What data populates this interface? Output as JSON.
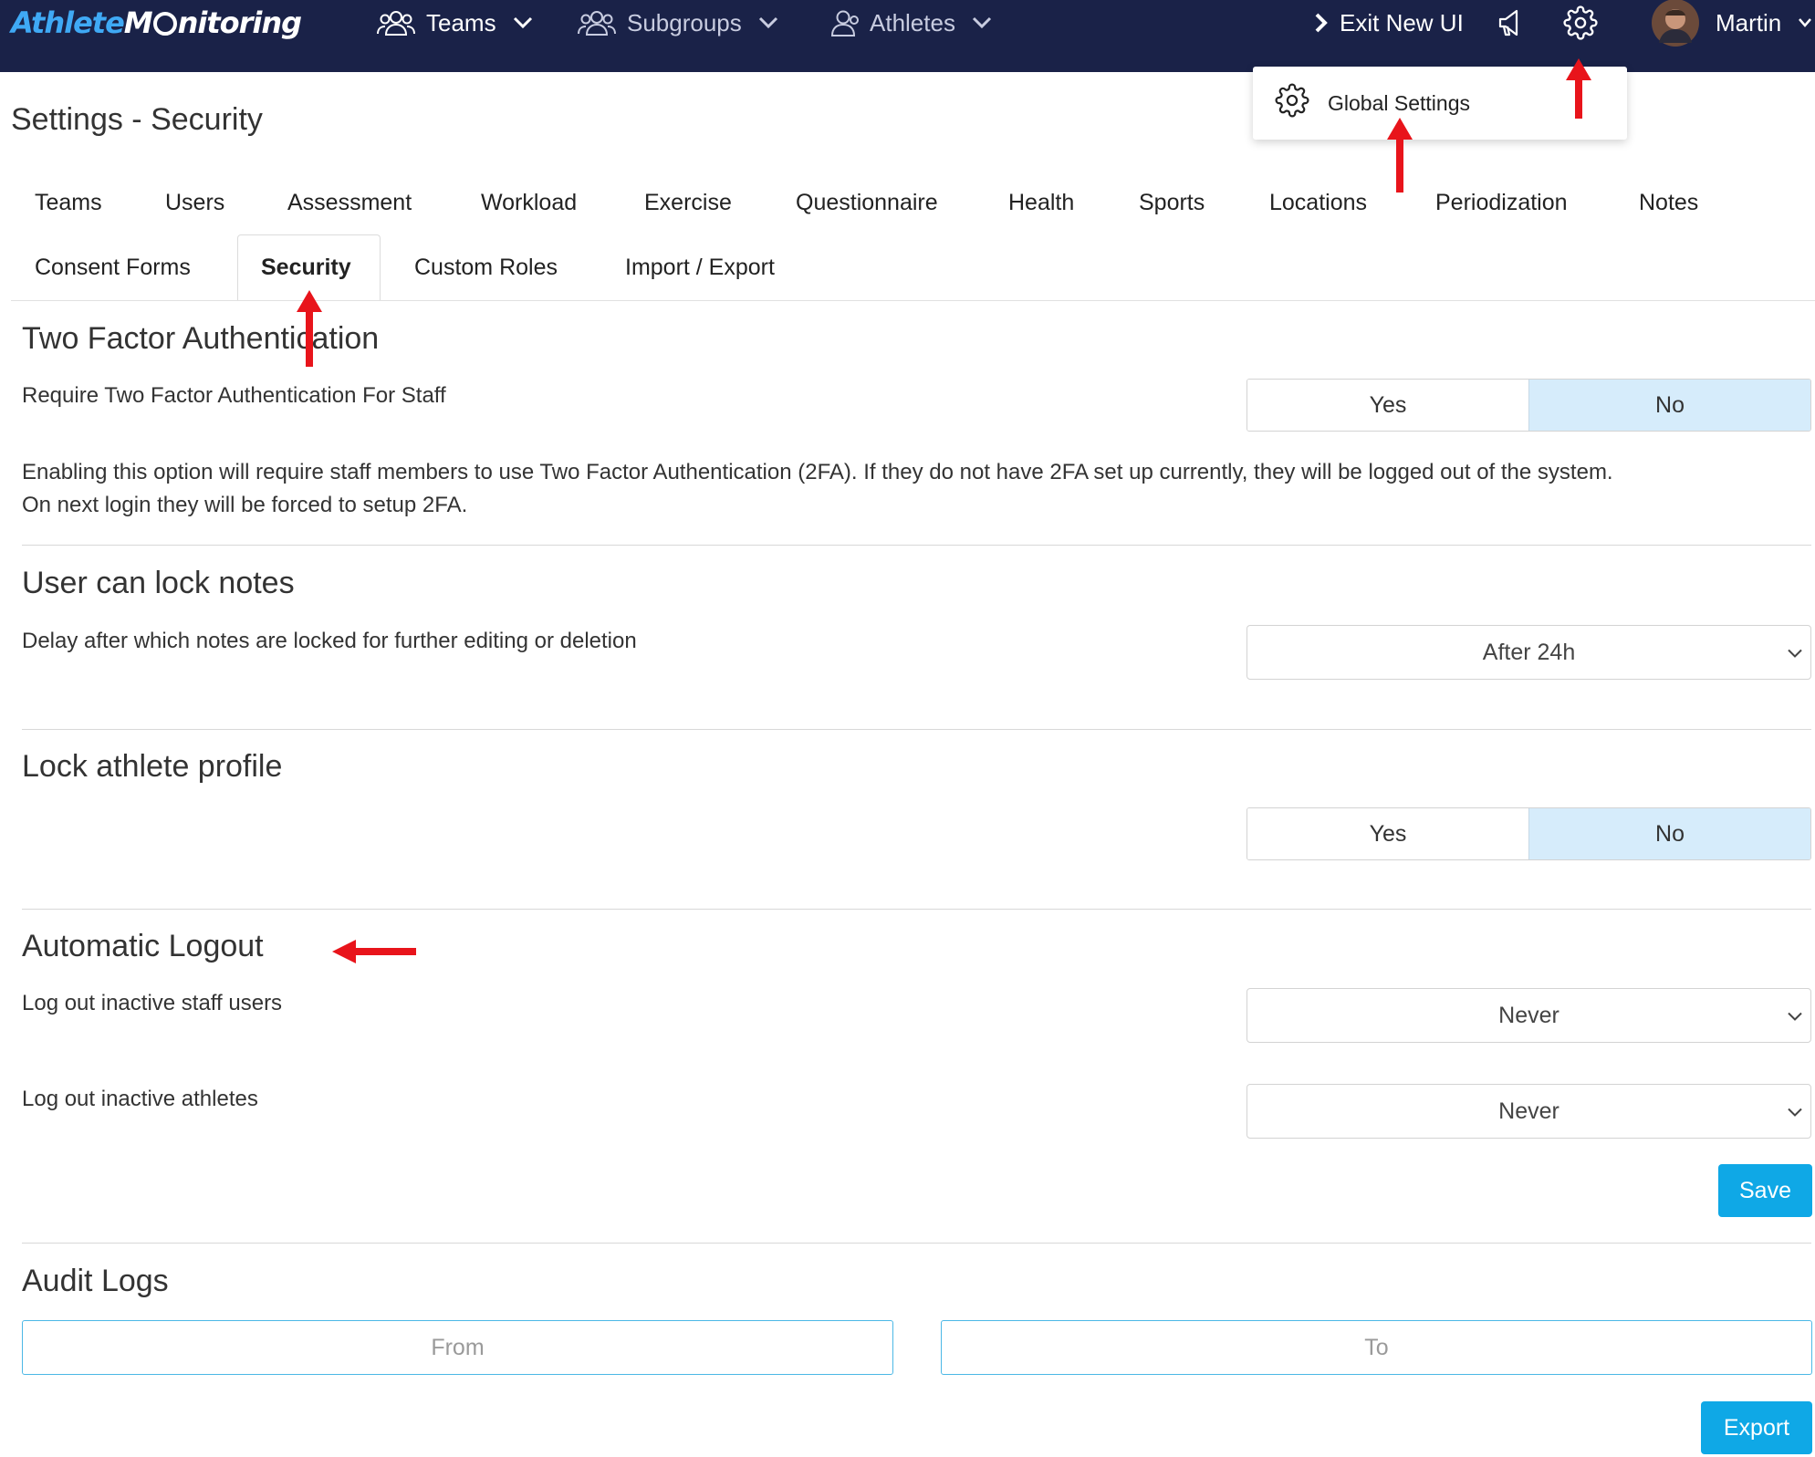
{
  "brand": {
    "logo_prefix": "Athlete",
    "logo_suffix_1": "M",
    "logo_suffix_2": "nitoring"
  },
  "topnav": {
    "teams_label": "Teams",
    "subgroups_label": "Subgroups",
    "athletes_label": "Athletes",
    "exit_label": "Exit New UI",
    "user_name": "Martin"
  },
  "settings_menu": {
    "global_settings_label": "Global Settings"
  },
  "page": {
    "title": "Settings - Security"
  },
  "tabs": {
    "row1": [
      "Teams",
      "Users",
      "Assessment",
      "Workload",
      "Exercise",
      "Questionnaire",
      "Health",
      "Sports",
      "Locations",
      "Periodization",
      "Notes"
    ],
    "row2": [
      "Consent Forms",
      "Security",
      "Custom Roles",
      "Import / Export"
    ],
    "active": "Security"
  },
  "two_factor": {
    "heading": "Two Factor Authentication",
    "label": "Require Two Factor Authentication For Staff",
    "options": [
      "Yes",
      "No"
    ],
    "selected": "No",
    "description_line1": "Enabling this option will require staff members to use Two Factor Authentication (2FA). If they do not have 2FA set up currently, they will be logged out of the system.",
    "description_line2": "On next login they will be forced to setup 2FA."
  },
  "lock_notes": {
    "heading": "User can lock notes",
    "label": "Delay after which notes are locked for further editing or deletion",
    "selected": "After 24h"
  },
  "lock_profile": {
    "heading": "Lock athlete profile",
    "options": [
      "Yes",
      "No"
    ],
    "selected": "No"
  },
  "auto_logout": {
    "heading": "Automatic Logout",
    "staff_label": "Log out inactive staff users",
    "staff_value": "Never",
    "athletes_label": "Log out inactive athletes",
    "athletes_value": "Never",
    "save_label": "Save"
  },
  "audit_logs": {
    "heading": "Audit Logs",
    "from_placeholder": "From",
    "to_placeholder": "To",
    "export_label": "Export"
  },
  "colors": {
    "topbar": "#1a2248",
    "primary_button": "#0fa8e6",
    "toggle_selected": "#d6ecfb",
    "annotation_arrow": "#e8141b"
  },
  "icons": [
    "users-icon",
    "chevron-down-icon",
    "chevron-right-icon",
    "megaphone-icon",
    "gear-icon",
    "avatar"
  ]
}
